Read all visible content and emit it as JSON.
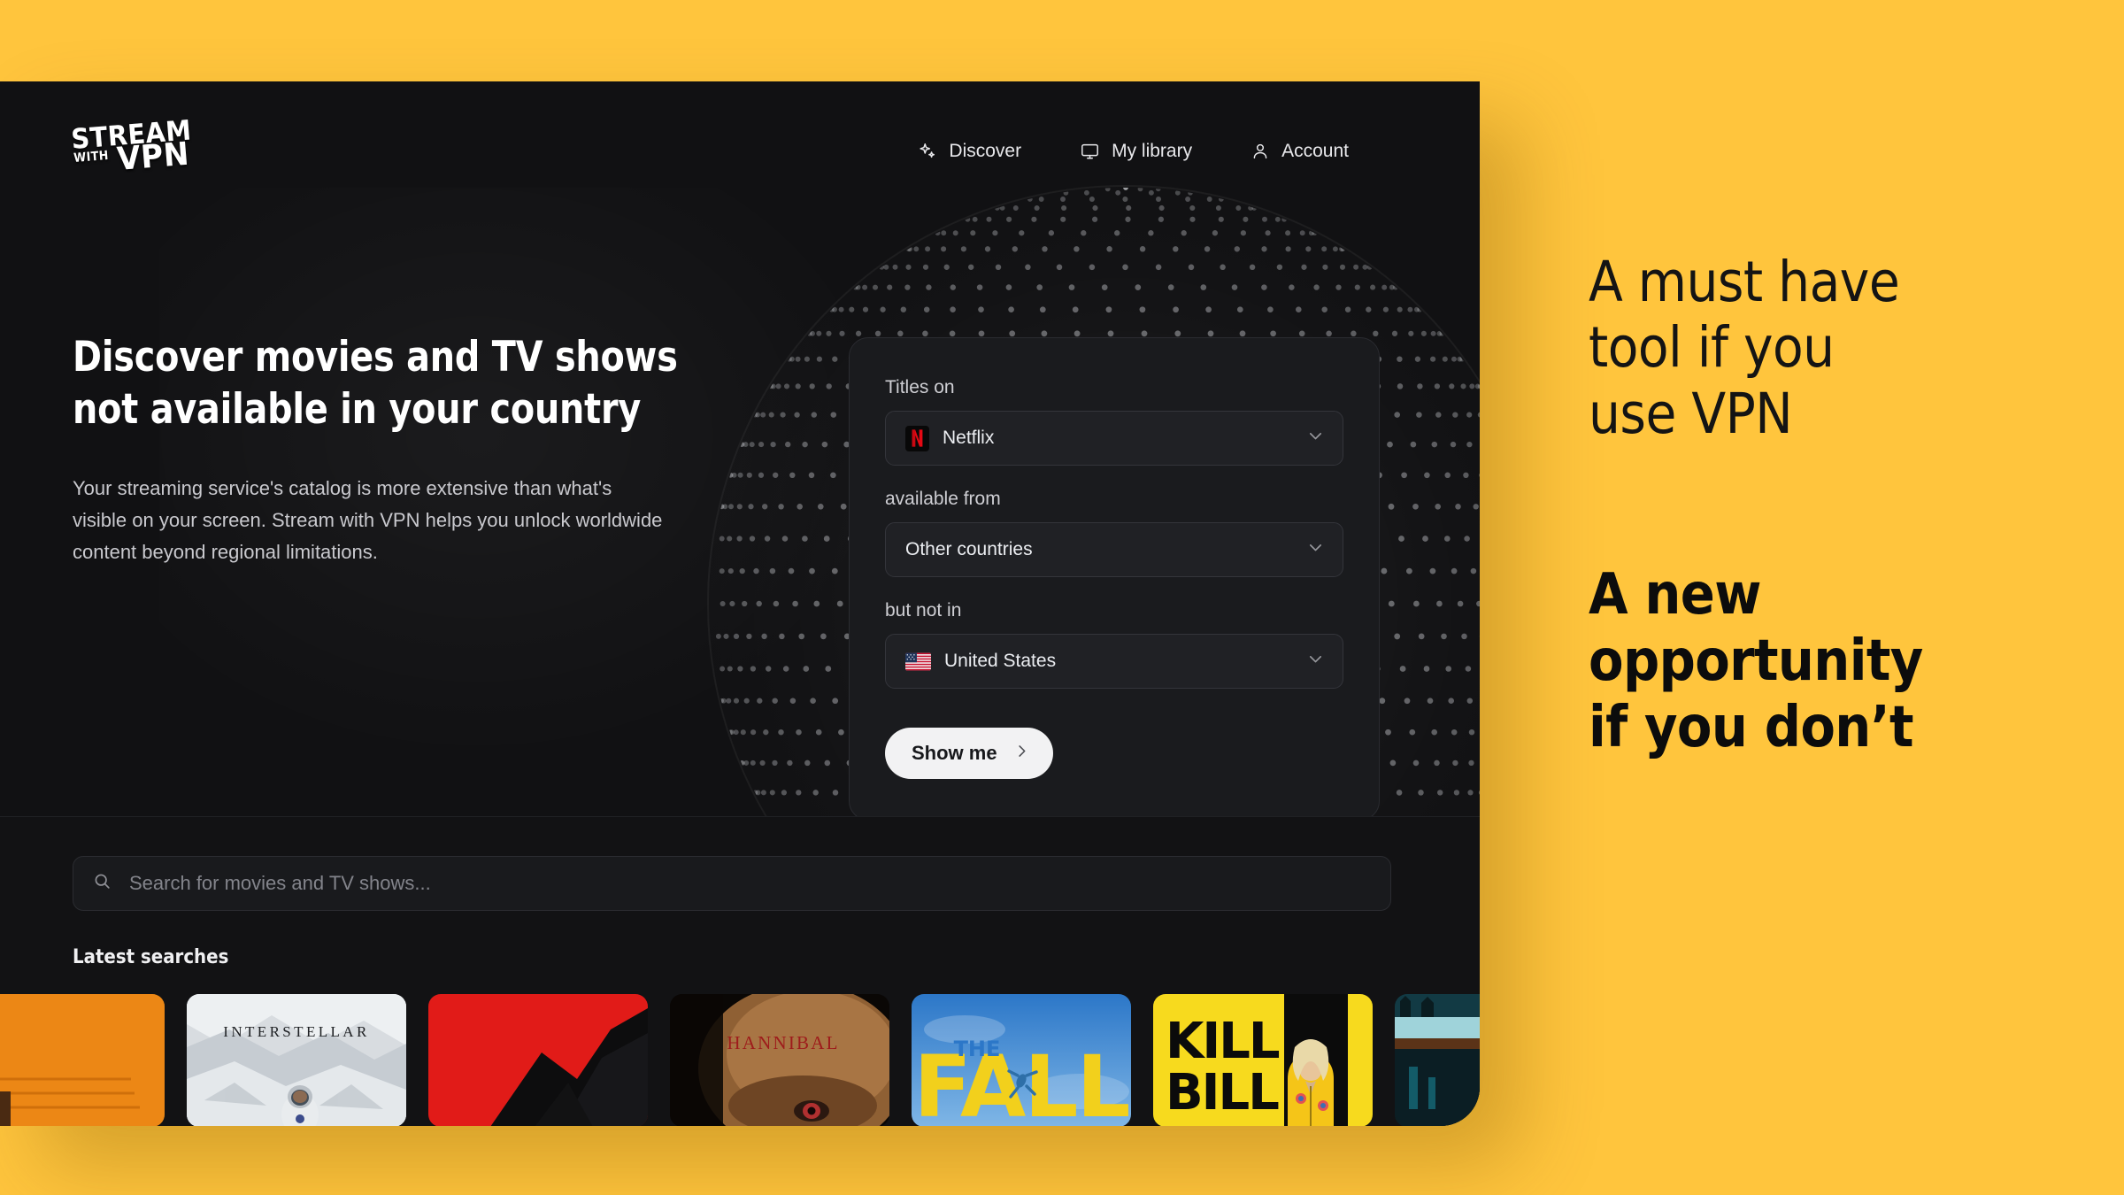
{
  "theme": {
    "brand_yellow": "#FFC53D",
    "app_background": "#121214",
    "card_background": "#1a1b1e",
    "accent_dot": "#F5A623",
    "netflix_red": "#E50914",
    "text_primary": "#FFFFFF",
    "text_secondary": "#C9C9CE"
  },
  "app": {
    "logo": {
      "line1": "STREAM",
      "line2": "WITH",
      "line3": "VPN"
    },
    "nav": [
      {
        "label": "Discover",
        "icon": "sparkles-icon"
      },
      {
        "label": "My library",
        "icon": "monitor-icon"
      },
      {
        "label": "Account",
        "icon": "person-icon"
      }
    ],
    "hero": {
      "headline": "Discover movies and TV shows\nnot available in your country",
      "subcopy": "Your streaming service's catalog is more extensive than what's\nvisible on your screen. Stream with VPN helps you unlock worldwide\ncontent beyond regional limitations."
    },
    "filter_card": {
      "label_service": "Titles on",
      "service_value": "Netflix",
      "label_available": "available from",
      "available_value": "Other countries",
      "label_excluded": "but not in",
      "excluded_value": "United States",
      "submit_label": "Show me"
    },
    "search": {
      "placeholder": "Search for movies and TV shows...",
      "latest_title": "Latest searches"
    },
    "posters": [
      {
        "title": "",
        "style": "orange-figure"
      },
      {
        "title": "INTERSTELLAR",
        "style": "interstellar"
      },
      {
        "title": "",
        "style": "red-mountain"
      },
      {
        "title": "HANNIBAL",
        "style": "hannibal"
      },
      {
        "title": "THE FALL",
        "style": "the-fall"
      },
      {
        "title": "KILL BILL",
        "style": "kill-bill"
      },
      {
        "title": "",
        "style": "teal-scene"
      }
    ]
  },
  "promo": {
    "light_text": "A must have\ntool if you\nuse VPN",
    "bold_text": "A new\nopportunity\nif you don’t"
  }
}
